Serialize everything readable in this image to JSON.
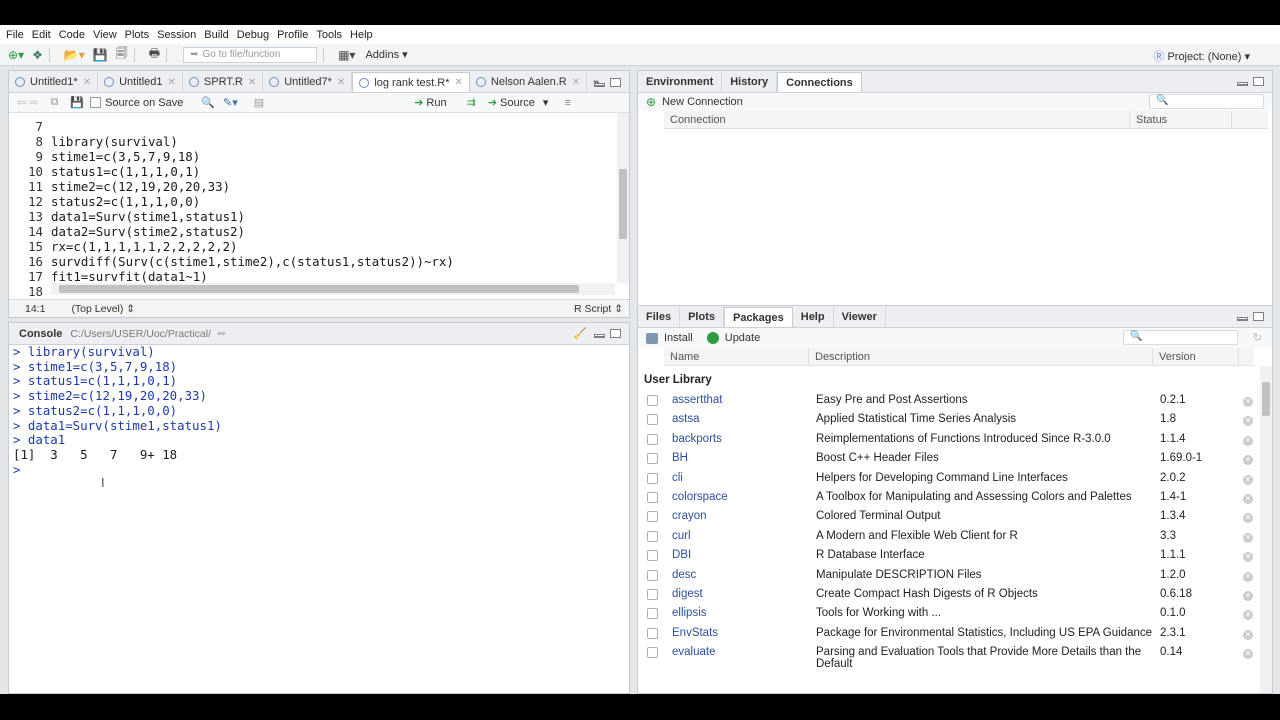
{
  "menu": [
    "File",
    "Edit",
    "Code",
    "View",
    "Plots",
    "Session",
    "Build",
    "Debug",
    "Profile",
    "Tools",
    "Help"
  ],
  "toolbar": {
    "goto_placeholder": "Go to file/function",
    "addins": "Addins",
    "project": "Project: (None)"
  },
  "editor": {
    "tabs": [
      {
        "label": "Untitled1*",
        "active": false
      },
      {
        "label": "Untitled1",
        "active": false
      },
      {
        "label": "SPRT.R",
        "active": false
      },
      {
        "label": "Untitled7*",
        "active": false
      },
      {
        "label": "log rank test.R*",
        "active": true
      },
      {
        "label": "Nelson Aalen.R",
        "active": false
      }
    ],
    "source_on_save": "Source on Save",
    "run": "Run",
    "source": "Source",
    "lines": [
      {
        "n": "7",
        "code": ""
      },
      {
        "n": "8",
        "code": "library(survival)"
      },
      {
        "n": "9",
        "code": "stime1=c(3,5,7,9,18)"
      },
      {
        "n": "10",
        "code": "status1=c(1,1,1,0,1)"
      },
      {
        "n": "11",
        "code": "stime2=c(12,19,20,20,33)"
      },
      {
        "n": "12",
        "code": "status2=c(1,1,1,0,0)"
      },
      {
        "n": "13",
        "code": "data1=Surv(stime1,status1)"
      },
      {
        "n": "14",
        "code": "data2=Surv(stime2,status2)"
      },
      {
        "n": "15",
        "code": "rx=c(1,1,1,1,1,2,2,2,2,2)"
      },
      {
        "n": "16",
        "code": "survdiff(Surv(c(stime1,stime2),c(status1,status2))~rx)"
      },
      {
        "n": "17",
        "code": "fit1=survfit(data1~1)"
      },
      {
        "n": "18",
        "code": ""
      }
    ],
    "status_pos": "14:1",
    "status_scope": "(Top Level)",
    "status_type": "R Script"
  },
  "console": {
    "title": "Console",
    "path": "C:/Users/USER/Uoc/Practical/",
    "lines": [
      "> library(survival)",
      "> stime1=c(3,5,7,9,18)",
      "> status1=c(1,1,1,0,1)",
      "> stime2=c(12,19,20,20,33)",
      "> status2=c(1,1,1,0,0)",
      "> data1=Surv(stime1,status1)",
      "> data1",
      "[1]  3   5   7   9+ 18",
      ">"
    ]
  },
  "env": {
    "tabs": [
      "Environment",
      "History",
      "Connections"
    ],
    "active": "Connections",
    "new_connection": "New Connection",
    "col_connection": "Connection",
    "col_status": "Status"
  },
  "files": {
    "tabs": [
      "Files",
      "Plots",
      "Packages",
      "Help",
      "Viewer"
    ],
    "active": "Packages",
    "install": "Install",
    "update": "Update",
    "col_name": "Name",
    "col_desc": "Description",
    "col_version": "Version",
    "section": "User Library",
    "packages": [
      {
        "name": "assertthat",
        "desc": "Easy Pre and Post Assertions",
        "ver": "0.2.1"
      },
      {
        "name": "astsa",
        "desc": "Applied Statistical Time Series Analysis",
        "ver": "1.8"
      },
      {
        "name": "backports",
        "desc": "Reimplementations of Functions Introduced Since R-3.0.0",
        "ver": "1.1.4"
      },
      {
        "name": "BH",
        "desc": "Boost C++ Header Files",
        "ver": "1.69.0-1"
      },
      {
        "name": "cli",
        "desc": "Helpers for Developing Command Line Interfaces",
        "ver": "2.0.2"
      },
      {
        "name": "colorspace",
        "desc": "A Toolbox for Manipulating and Assessing Colors and Palettes",
        "ver": "1.4-1"
      },
      {
        "name": "crayon",
        "desc": "Colored Terminal Output",
        "ver": "1.3.4"
      },
      {
        "name": "curl",
        "desc": "A Modern and Flexible Web Client for R",
        "ver": "3.3"
      },
      {
        "name": "DBI",
        "desc": "R Database Interface",
        "ver": "1.1.1"
      },
      {
        "name": "desc",
        "desc": "Manipulate DESCRIPTION Files",
        "ver": "1.2.0"
      },
      {
        "name": "digest",
        "desc": "Create Compact Hash Digests of R Objects",
        "ver": "0.6.18"
      },
      {
        "name": "ellipsis",
        "desc": "Tools for Working with ...",
        "ver": "0.1.0"
      },
      {
        "name": "EnvStats",
        "desc": "Package for Environmental Statistics, Including US EPA Guidance",
        "ver": "2.3.1"
      },
      {
        "name": "evaluate",
        "desc": "Parsing and Evaluation Tools that Provide More Details than the",
        "desc2": "Default",
        "ver": "0.14"
      }
    ]
  }
}
